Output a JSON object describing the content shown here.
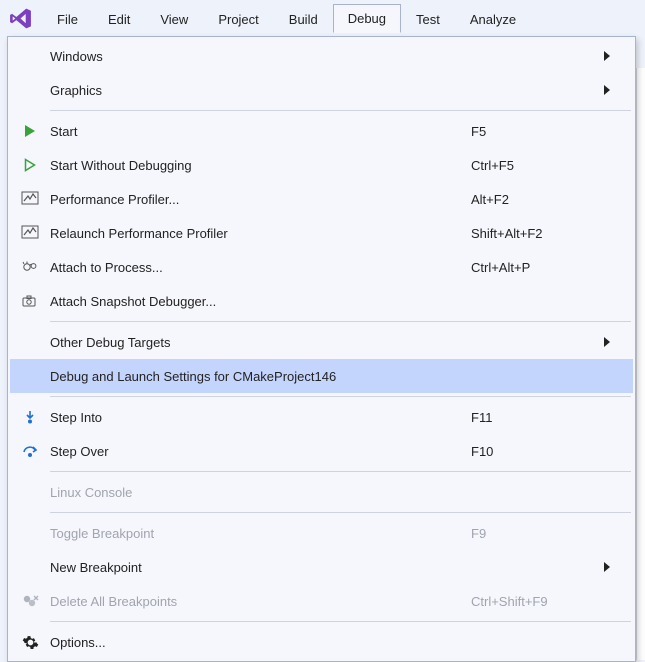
{
  "menubar": {
    "items": [
      {
        "label": "File"
      },
      {
        "label": "Edit"
      },
      {
        "label": "View"
      },
      {
        "label": "Project"
      },
      {
        "label": "Build"
      },
      {
        "label": "Debug",
        "open": true
      },
      {
        "label": "Test"
      },
      {
        "label": "Analyze"
      }
    ]
  },
  "dropdown": {
    "items": [
      {
        "label": "Windows",
        "submenu": true
      },
      {
        "label": "Graphics",
        "submenu": true
      },
      {
        "sep": true
      },
      {
        "label": "Start",
        "shortcut": "F5",
        "icon": "play-green"
      },
      {
        "label": "Start Without Debugging",
        "shortcut": "Ctrl+F5",
        "icon": "play-outline"
      },
      {
        "label": "Performance Profiler...",
        "shortcut": "Alt+F2",
        "icon": "profiler"
      },
      {
        "label": "Relaunch Performance Profiler",
        "shortcut": "Shift+Alt+F2",
        "icon": "profiler"
      },
      {
        "label": "Attach to Process...",
        "shortcut": "Ctrl+Alt+P",
        "icon": "attach-process"
      },
      {
        "label": "Attach Snapshot Debugger...",
        "icon": "snapshot"
      },
      {
        "sep": true
      },
      {
        "label": "Other Debug Targets",
        "submenu": true
      },
      {
        "label": "Debug and Launch Settings for CMakeProject146",
        "highlighted": true
      },
      {
        "sep": true
      },
      {
        "label": "Step Into",
        "shortcut": "F11",
        "icon": "step-into"
      },
      {
        "label": "Step Over",
        "shortcut": "F10",
        "icon": "step-over"
      },
      {
        "sep": true
      },
      {
        "label": "Linux Console",
        "disabled": true
      },
      {
        "sep": true
      },
      {
        "label": "Toggle Breakpoint",
        "shortcut": "F9",
        "disabled": true
      },
      {
        "label": "New Breakpoint",
        "submenu": true
      },
      {
        "label": "Delete All Breakpoints",
        "shortcut": "Ctrl+Shift+F9",
        "icon": "delete-breakpoints",
        "disabled": true
      },
      {
        "sep": true
      },
      {
        "label": "Options...",
        "icon": "gear"
      }
    ]
  }
}
